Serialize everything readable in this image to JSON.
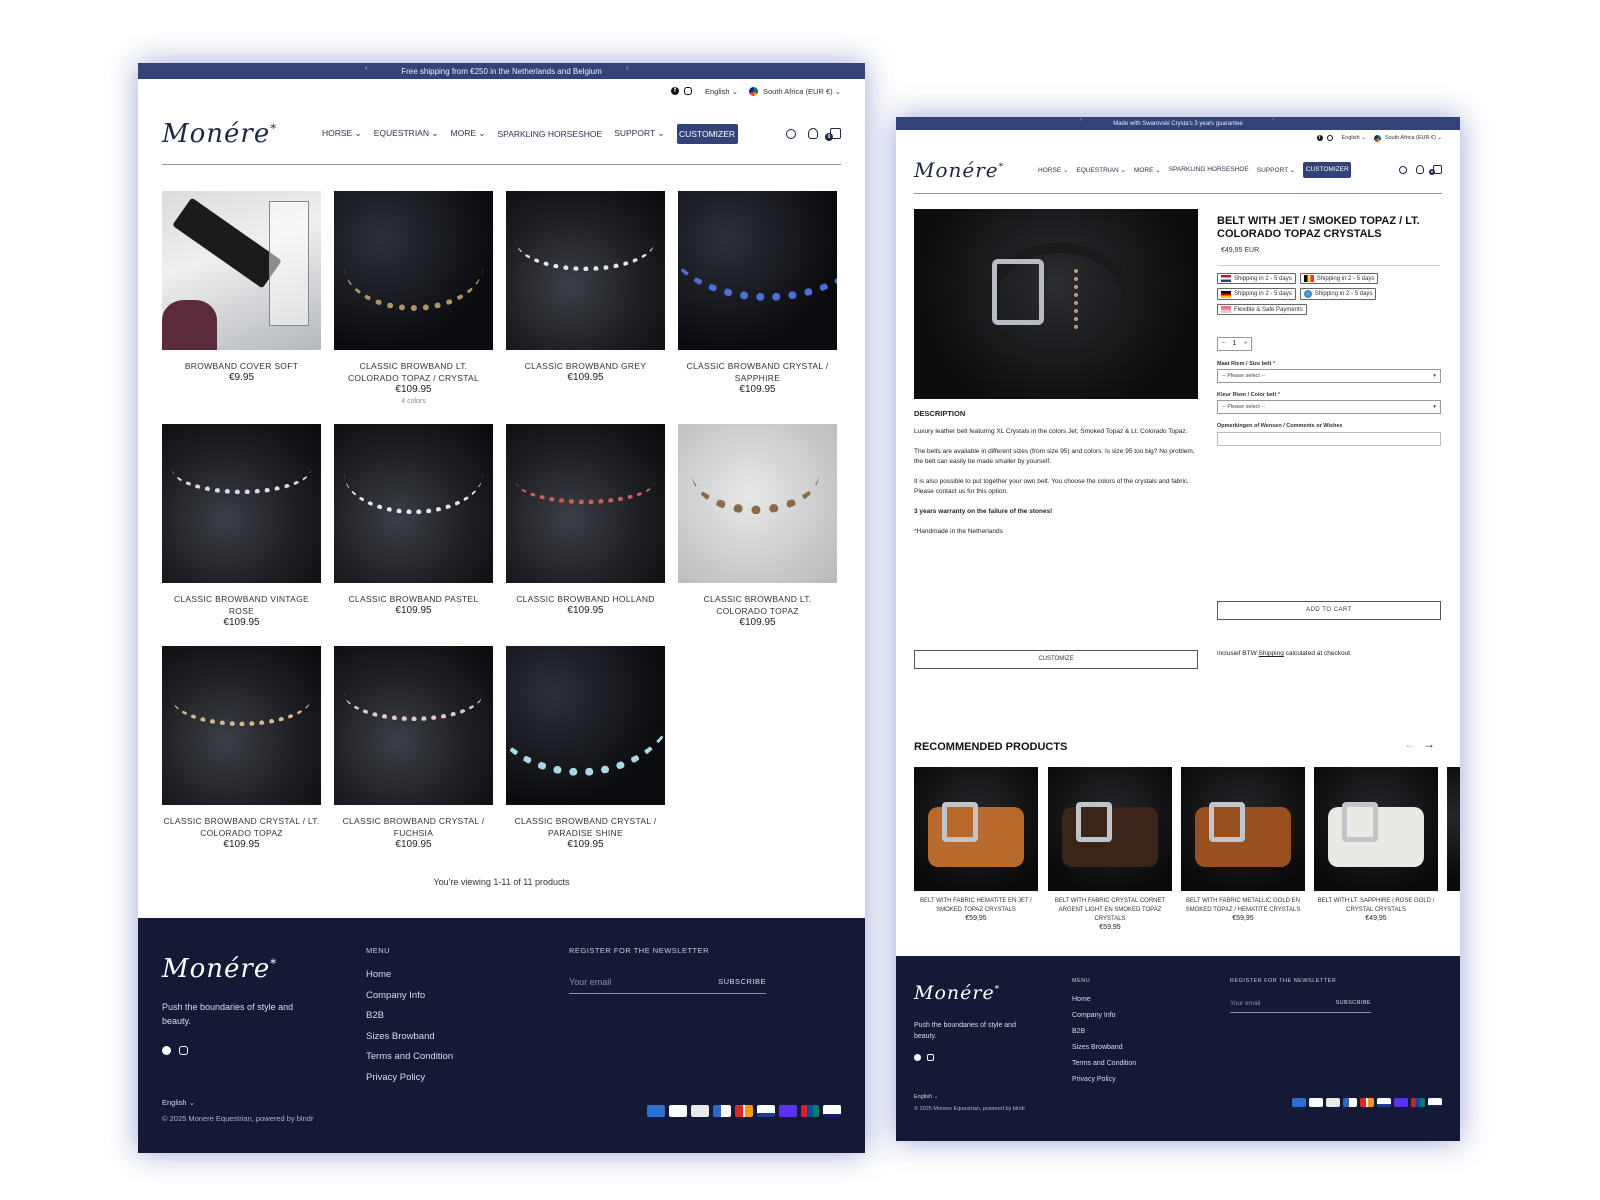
{
  "store": {
    "logo_text": "Monére",
    "logo_mark": "*",
    "announcement_a": "Free shipping from €250 in the Netherlands and Belgium",
    "announcement_b": "Made with Swarovski Crysta's 3 years guarantee",
    "prev_arrow": "‹",
    "next_arrow": "›",
    "language": "English",
    "country": "South Africa (EUR €)",
    "nav": {
      "horse": "HORSE",
      "equestrian": "EQUESTRIAN",
      "more": "MORE",
      "sparkling": "SPARKLING HORSESHOE",
      "support": "SUPPORT",
      "customizer": "CUSTOMIZER"
    },
    "cart_count": "0",
    "chevron": "⌄"
  },
  "collection": {
    "products": [
      {
        "name": "BROWBAND COVER SOFT",
        "price": "€9.95"
      },
      {
        "name": "CLASSIC BROWBAND LT. COLORADO TOPAZ / CRYSTAL",
        "price": "€109.95",
        "colors": "4 colors"
      },
      {
        "name": "CLASSIC BROWBAND GREY",
        "price": "€109.95"
      },
      {
        "name": "CLASSIC BROWBAND CRYSTAL / SAPPHIRE",
        "price": "€109.95"
      },
      {
        "name": "CLASSIC BROWBAND VINTAGE ROSE",
        "price": "€109.95"
      },
      {
        "name": "CLASSIC BROWBAND PASTEL",
        "price": "€109.95"
      },
      {
        "name": "CLASSIC BROWBAND HOLLAND",
        "price": "€109.95"
      },
      {
        "name": "CLASSIC BROWBAND LT. COLORADO TOPAZ",
        "price": "€109.95"
      },
      {
        "name": "CLASSIC BROWBAND CRYSTAL / LT. COLORADO TOPAZ",
        "price": "€109.95"
      },
      {
        "name": "CLASSIC BROWBAND CRYSTAL / FUCHSIA",
        "price": "€109.95"
      },
      {
        "name": "CLASSIC BROWBAND CRYSTAL / PARADISE SHINE",
        "price": "€109.95"
      }
    ],
    "viewing": "You're viewing 1-11 of 11 products"
  },
  "product": {
    "title": "BELT WITH JET / SMOKED TOPAZ / LT. COLORADO TOPAZ CRYSTALS",
    "price": "€49,95 EUR",
    "badges": [
      "Shipping in 2 - 5 days",
      "Shipping in 2 - 5 days",
      "Shipping in 2 - 5 days",
      "Shipping in 2 - 5 days",
      "Flexible & Safe Payments"
    ],
    "qty_minus": "−",
    "qty_value": "1",
    "qty_plus": "+",
    "size_label": "Maat Riem / Size belt",
    "color_label": "Kleur Riem / Color belt",
    "required_mark": "*",
    "select_placeholder": "-- Please select --",
    "comments_label": "Opmerkingen of Wensen / Comments or Wishes",
    "add_to_cart": "ADD TO CART",
    "customize": "CUSTOMIZE",
    "tax_note_prefix": "inclusief BTW",
    "tax_note_link": "Shipping",
    "tax_note_suffix": "calculated at checkout.",
    "description_heading": "DESCRIPTION",
    "description": [
      "Luxury leather belt featuring XL Crystals in the colors Jet, Smoked Topaz & Lt. Colorado Topaz.",
      "The belts are available in different sizes (from size 95) and colors. Is size 95 too big? No problem, the belt can easily be made smaller by yourself.",
      "It is also possible to put together your own belt. You choose the colors of the crystals and fabric. Please contact us for this option.",
      "3 years warranty on the failure of the stones!",
      "*Handmade in the Netherlands"
    ],
    "recommended_heading": "RECOMMENDED PRODUCTS",
    "rec_prev": "←",
    "rec_next": "→",
    "recommended": [
      {
        "name": "BELT WITH FABRIC HEMATITE EN JET / SMOKED TOPAZ CRYSTALS",
        "price": "€59,95",
        "color": "#b76a2c"
      },
      {
        "name": "BELT WITH FABRIC CRYSTAL CORNET ARGENT LIGHT EN SMOKED TOPAZ CRYSTALS",
        "price": "€59,95",
        "color": "#3b2418"
      },
      {
        "name": "BELT WITH FABRIC METALLIC GOLD EN SMOKED TOPAZ / HEMATITE CRYSTALS",
        "price": "€59,95",
        "color": "#9a4f1f"
      },
      {
        "name": "BELT WITH LT. SAPPHIRE / ROSE GOLD / CRYSTAL CRYSTALS",
        "price": "€49,95",
        "color": "#e9e9e6"
      }
    ]
  },
  "footer": {
    "tagline": "Push the boundaries of style and beauty.",
    "menu_title": "MENU",
    "menu": [
      "Home",
      "Company Info",
      "B2B",
      "Sizes Browband",
      "Terms and Condition",
      "Privacy Policy"
    ],
    "newsletter_title": "REGISTER FOR THE NEWSLETTER",
    "email_placeholder": "Your email",
    "subscribe": "SUBSCRIBE",
    "language": "English",
    "copyright": "© 2025 Monere Equestrian, powered by blndr"
  },
  "colors": {
    "brand_navy": "#33437a",
    "footer_bg": "#141a36"
  },
  "payment_icons": [
    "amex-icon",
    "apple-pay-icon",
    "google-pay-icon",
    "maestro-icon",
    "mastercard-icon",
    "paypal-icon",
    "shop-pay-icon",
    "union-pay-icon",
    "visa-icon"
  ]
}
